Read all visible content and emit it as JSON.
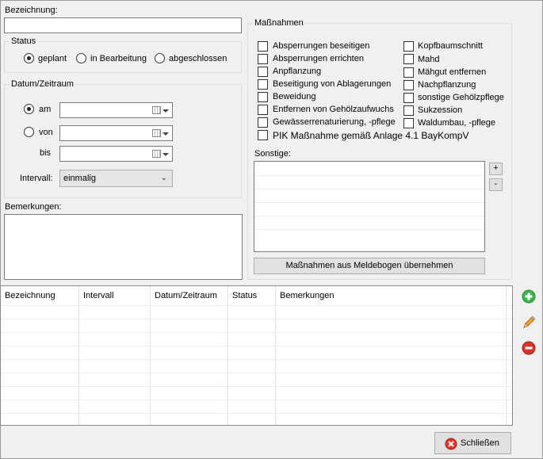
{
  "bezeichnung": {
    "label": "Bezeichnung:",
    "value": ""
  },
  "status": {
    "title": "Status",
    "options": [
      {
        "label": "geplant",
        "checked": true
      },
      {
        "label": "in Bearbeitung",
        "checked": false
      },
      {
        "label": "abgeschlossen",
        "checked": false
      }
    ]
  },
  "datum": {
    "title": "Datum/Zeitraum",
    "am_label": "am",
    "von_label": "von",
    "bis_label": "bis",
    "intervall_label": "Intervall:",
    "intervall_value": "einmalig"
  },
  "bemerkungen": {
    "label": "Bemerkungen:",
    "value": ""
  },
  "massnahmen": {
    "title": "Maßnahmen",
    "left": [
      "Absperrungen beseitigen",
      "Absperrungen errichten",
      "Anpflanzung",
      "Beseitigung von Ablagerungen",
      "Beweidung",
      "Entfernen von Gehölzaufwuchs",
      "Gewässerrenaturierung, -pflege"
    ],
    "right": [
      "Kopfbaumschnitt",
      "Mahd",
      "Mähgut entfernen",
      "Nachpflanzung",
      "sonstige Gehölzpflege",
      "Sukzession",
      "Waldumbau, -pflege"
    ],
    "pik": "PIK Maßnahme gemäß Anlage 4.1 BayKompV",
    "sonstige_label": "Sonstige:",
    "plus": "+",
    "minus": "-",
    "uebernehmen": "Maßnahmen aus Meldebogen übernehmen"
  },
  "table": {
    "columns": [
      "Bezeichnung",
      "Intervall",
      "Datum/Zeitraum",
      "Status",
      "Bemerkungen"
    ]
  },
  "icons": {
    "add": "add-icon",
    "edit": "pencil-icon",
    "delete": "delete-icon",
    "close": "close-icon"
  },
  "colors": {
    "add": "#3bb54a",
    "delete": "#d9342b",
    "edit": "#e8a33d"
  },
  "footer": {
    "close_label": "Schließen"
  }
}
